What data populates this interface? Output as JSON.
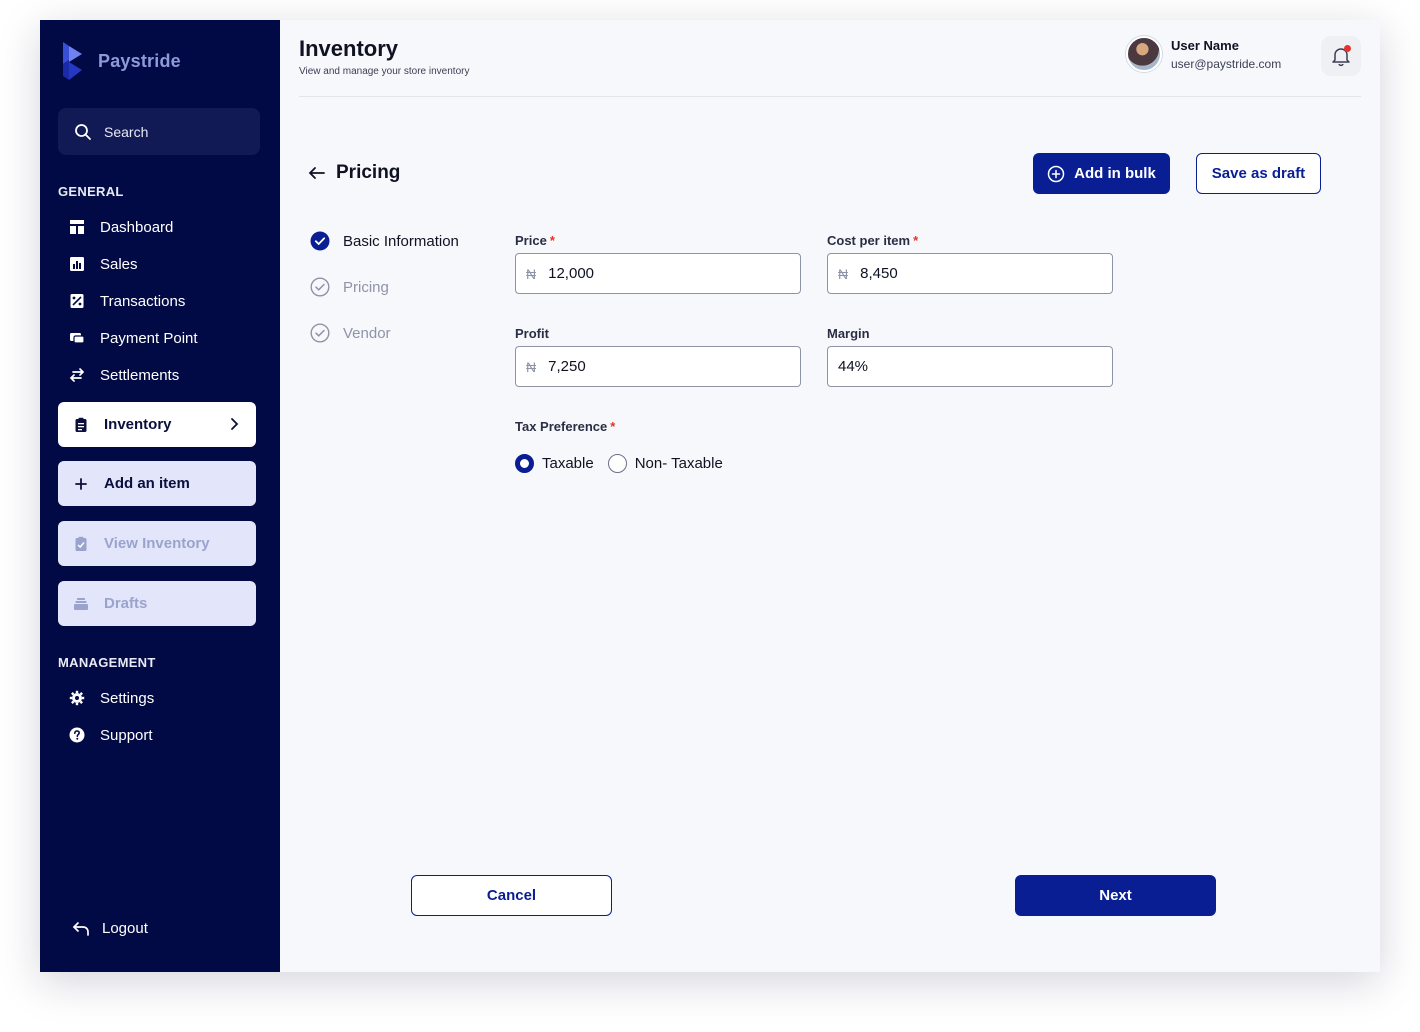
{
  "brand": {
    "name": "Paystride"
  },
  "search": {
    "placeholder": "Search"
  },
  "sidebar": {
    "general_title": "GENERAL",
    "general_items": [
      {
        "label": "Dashboard",
        "icon": "dashboard-icon"
      },
      {
        "label": "Sales",
        "icon": "sales-chart-icon"
      },
      {
        "label": "Transactions",
        "icon": "transactions-icon"
      },
      {
        "label": "Payment Point",
        "icon": "payment-point-icon"
      },
      {
        "label": "Settlements",
        "icon": "swap-arrows-icon"
      }
    ],
    "inventory": {
      "label": "Inventory",
      "icon": "clipboard-icon"
    },
    "sub_items": [
      {
        "label": "Add an item",
        "icon": "plus-icon"
      },
      {
        "label": "View Inventory",
        "icon": "clipboard-check-icon"
      },
      {
        "label": "Drafts",
        "icon": "drafts-stack-icon"
      }
    ],
    "management_title": "MANAGEMENT",
    "management_items": [
      {
        "label": "Settings",
        "icon": "gear-icon"
      },
      {
        "label": "Support",
        "icon": "help-circle-icon"
      }
    ],
    "logout": {
      "label": "Logout",
      "icon": "logout-arrow-icon"
    }
  },
  "header": {
    "title": "Inventory",
    "subtitle": "View and manage your store inventory",
    "user_name": "User Name",
    "user_email": "user@paystride.com"
  },
  "page": {
    "section_title": "Pricing",
    "add_bulk_label": "Add in bulk",
    "save_draft_label": "Save as draft"
  },
  "steps": [
    {
      "label": "Basic Information",
      "state": "done"
    },
    {
      "label": "Pricing",
      "state": "pending"
    },
    {
      "label": "Vendor",
      "state": "pending"
    }
  ],
  "form": {
    "currency_symbol": "₦",
    "price": {
      "label": "Price",
      "value": "12,000"
    },
    "cost": {
      "label": "Cost per item",
      "value": "8,450"
    },
    "profit": {
      "label": "Profit",
      "value": "7,250"
    },
    "margin": {
      "label": "Margin",
      "value": "44%"
    },
    "tax": {
      "label": "Tax Preference",
      "options": [
        "Taxable",
        "Non- Taxable"
      ],
      "selected": "Taxable"
    },
    "required_mark": "*"
  },
  "footer": {
    "cancel_label": "Cancel",
    "next_label": "Next"
  },
  "colors": {
    "sidebar": "#020a45",
    "primary": "#0a1e94",
    "required": "#e5322d"
  }
}
